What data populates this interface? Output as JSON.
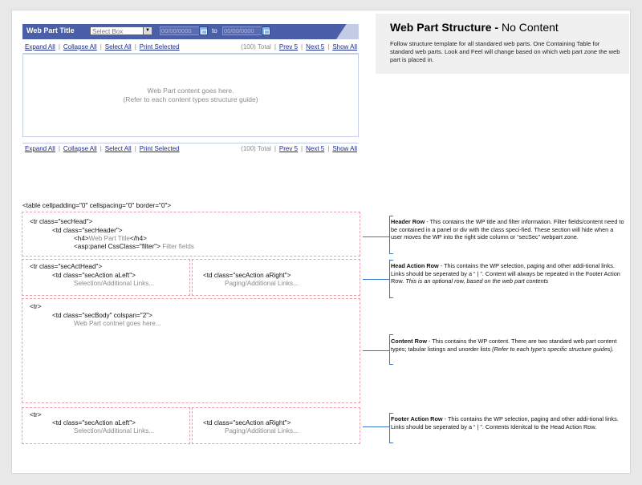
{
  "webpart": {
    "title": "Web Part Title",
    "select_box": "Select Box",
    "date_from_placeholder": "00/00/0000",
    "date_to_placeholder": "00/00/0000",
    "to_label": "to",
    "content_line1": "Web Part content goes here.",
    "content_line2": "(Refer to each content types structure guide)"
  },
  "actions": {
    "expand_all": "Expand All",
    "collapse_all": "Collapse All",
    "select_all": "Select All",
    "print_selected": "Print Selected",
    "total": "(100) Total",
    "prev": "Prev 5",
    "next": "Next 5",
    "show_all": "Show All",
    "separator": "|"
  },
  "info": {
    "title_bold": "Web Part Structure -",
    "title_rest": " No Content",
    "description": "Follow structure template for all standared web parts. One Containing Table for standard web parts. Look and Feel will change based on which web part zone the web part is placed in."
  },
  "code": {
    "table": "<table cellpadding=\"0\" cellspacing=\"0\" border=\"0\">",
    "tr_sechead": "<tr class=\"secHead\">",
    "td_secheader": "<td class=\"secHeader\">",
    "h4_open": "<h4>",
    "h4_text": "Web Part Title",
    "h4_close": "</h4>",
    "asp_panel": "<asp:panel CssClass=\"filter\">",
    "filter_text": " Filter fields",
    "tr_secacthead": "<tr class=\"secActHead\">",
    "td_aleft": "<td class=\"secAction aLeft\">",
    "selection_links": "Selection/Additional Links...",
    "td_aright": "<td class=\"secAction aRight\">",
    "paging_links": "Paging/Additional Links...",
    "tr": "<tr>",
    "td_secbody": "<td class=\"secBody\" colspan=\"2\">",
    "body_text": "Web Part contnet goes here...",
    "tr_footer": "<tr>",
    "td_aleft_footer": "<td class=\"secAction aLeft\">",
    "selection_links_footer": "Selection/Additional Links...",
    "td_aright_footer": "<td class=\"secAction aRight\">",
    "paging_links_footer": "Paging/Additional Links..."
  },
  "notes": {
    "header_title": "Header Row",
    "header_text": " - This contains the WP title and filter information. Filter fields/content need to be contained in a panel or div with the class speci-fied. These section will hide when a user moves the WP into the right side column or “secSec” webpart zone.",
    "head_action_title": "Head Action Row",
    "head_action_text": " - This contains the WP selection, paging and other addi-tional links. Links should be seperated by a “ | ”. Content will always be repeated in the Footer Action Row. ",
    "head_action_italic": "This is an optional row, based on the web part contents",
    "content_title": "Content Row",
    "content_text": " - This contains the WP content. There are two standard web part content types; tabular listings and unorder lists ",
    "content_italic": "(Refer to each type's specific structure guides).",
    "footer_title": "Footer Action Row",
    "footer_text": " - This contains the WP selection, paging and other addi-tional links. Links should be seperated by a “ | ”. Contents Idenitcal to the Head Action Row."
  },
  "colors": {
    "header_blue": "#4a5fa8",
    "link_blue": "#1c2a8a",
    "dashed_pink": "#e7a0a8",
    "leader_blue": "#3a76c4"
  }
}
